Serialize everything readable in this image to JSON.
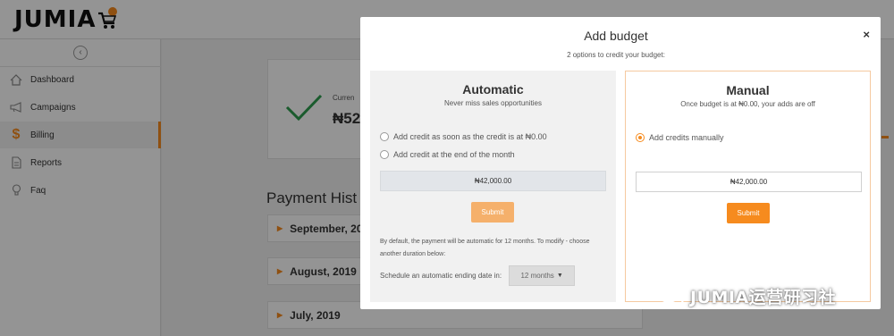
{
  "brand": {
    "logo_text": "JUMIA",
    "accent_color": "#f68b1e"
  },
  "sidebar": {
    "collapse_icon": "chevron-left-circle-icon",
    "items": [
      {
        "label": "Dashboard",
        "icon": "home-icon"
      },
      {
        "label": "Campaigns",
        "icon": "megaphone-icon"
      },
      {
        "label": "Billing",
        "icon": "dollar-icon",
        "active": true
      },
      {
        "label": "Reports",
        "icon": "document-icon"
      },
      {
        "label": "Faq",
        "icon": "lightbulb-icon"
      }
    ]
  },
  "main": {
    "status": {
      "label": "Curren",
      "value": "₦52",
      "icon": "check-icon"
    },
    "payment_history_title": "Payment Hist",
    "months": [
      "September, 20",
      "August, 2019",
      "July, 2019"
    ]
  },
  "modal": {
    "title": "Add budget",
    "subtitle": "2 options to credit your budget:",
    "close_label": "×",
    "automatic": {
      "title": "Automatic",
      "subtitle": "Never miss sales opportunities",
      "options": [
        "Add credit as soon as the credit is at ₦0.00",
        "Add credit at the end of the month"
      ],
      "amount": "₦42,000.00",
      "submit_label": "Submit",
      "note": "By default, the payment will be automatic for 12 months. To modify - choose another duration below:",
      "schedule_label": "Schedule an automatic ending date in:",
      "schedule_value": "12 months"
    },
    "manual": {
      "title": "Manual",
      "subtitle": "Once budget is at ₦0.00, your adds are off",
      "option": "Add credits manually",
      "amount": "₦42,000.00",
      "submit_label": "Submit"
    }
  },
  "watermark": {
    "text": "JUMIA运营研习社"
  }
}
